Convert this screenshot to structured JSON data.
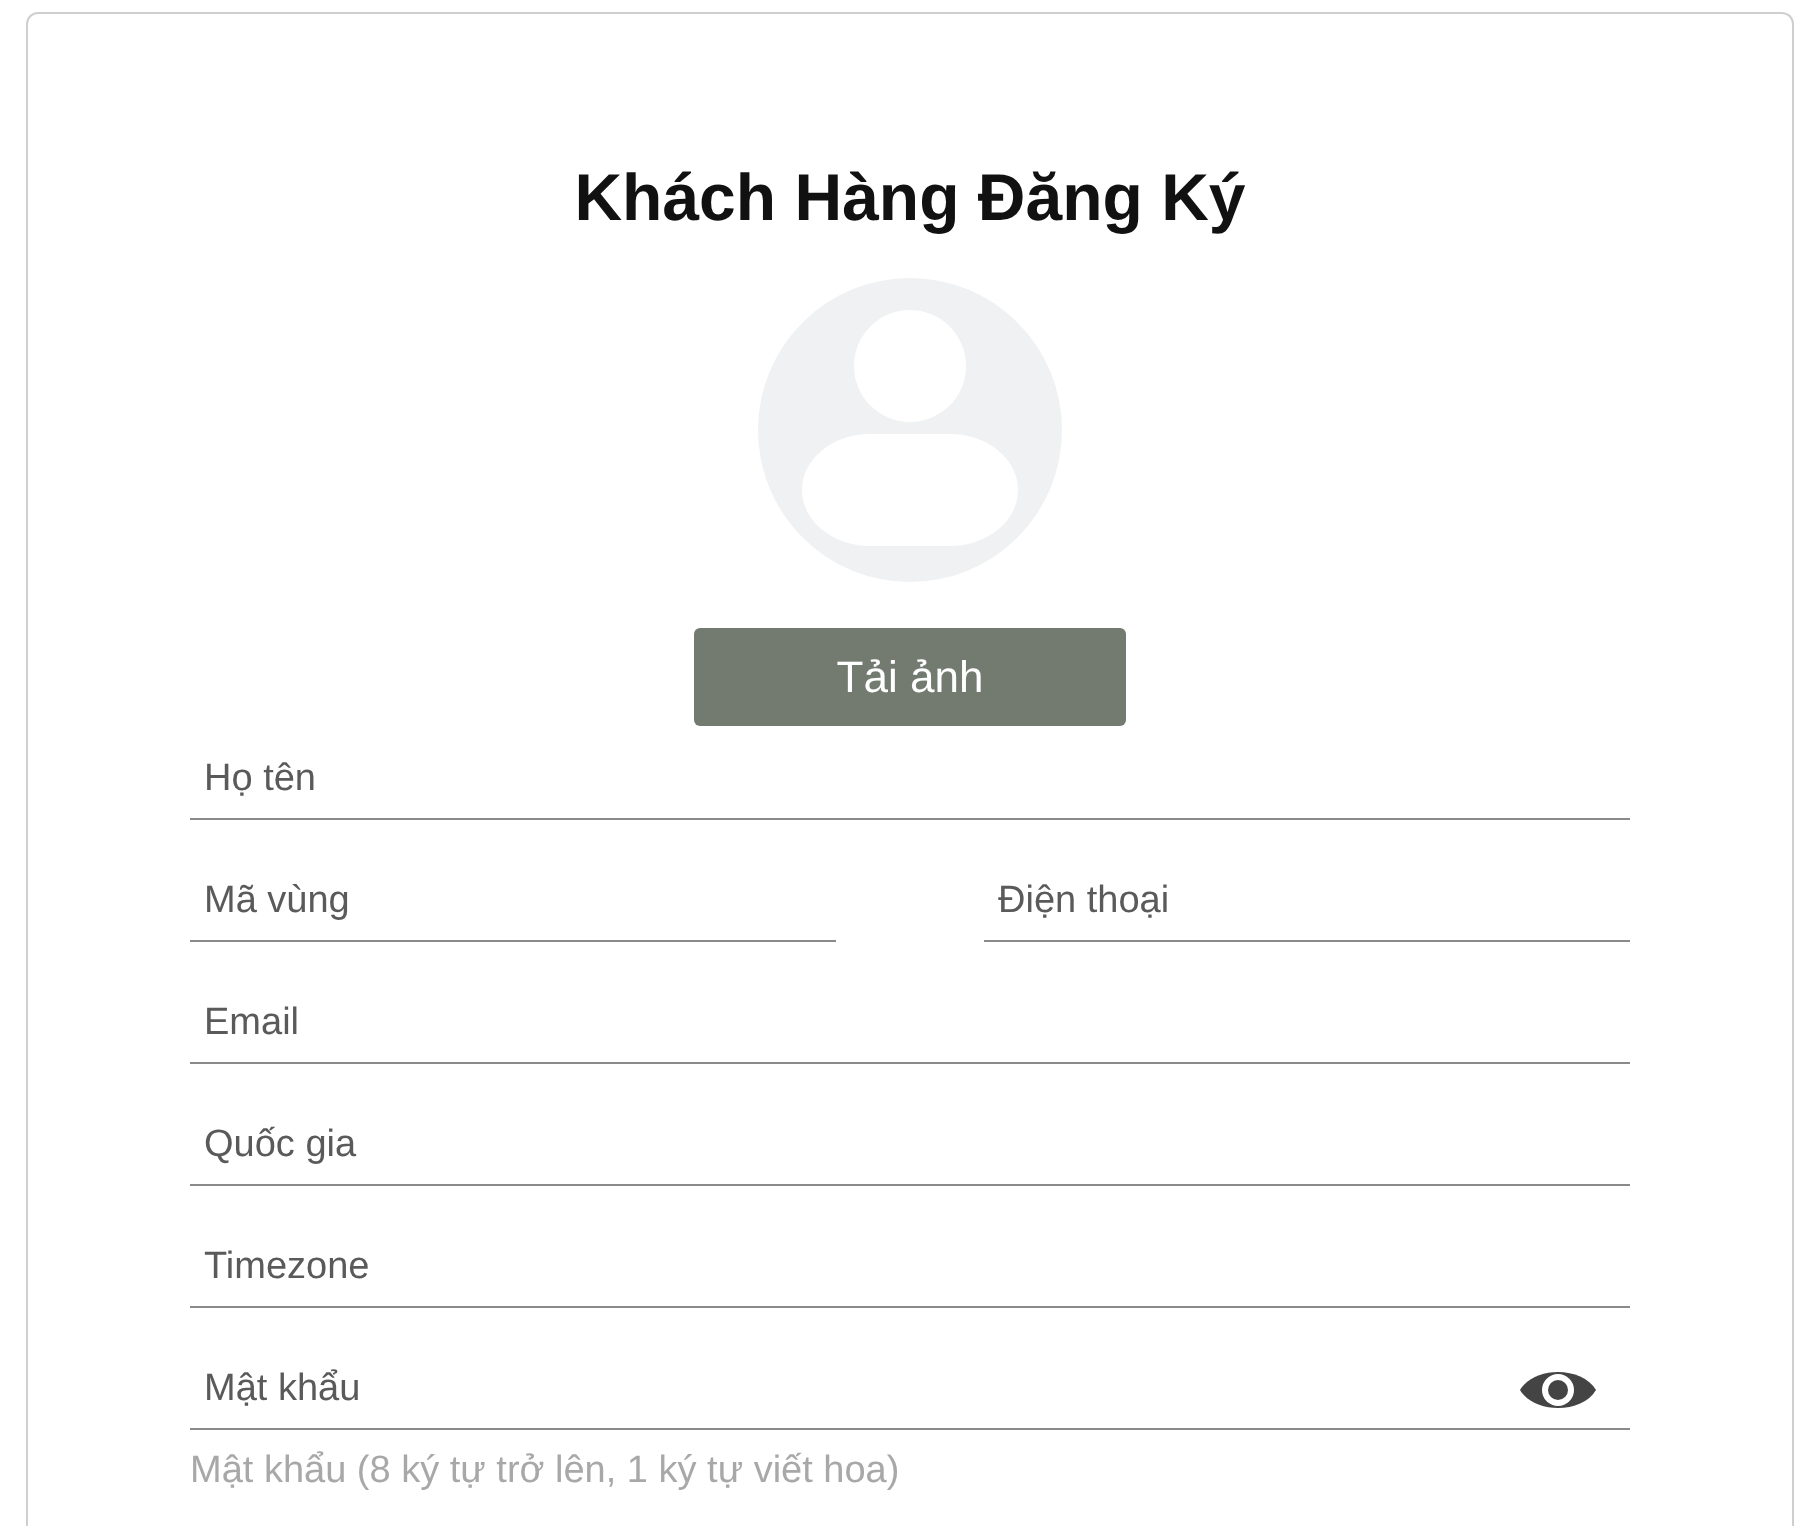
{
  "title": "Khách Hàng Đăng Ký",
  "upload_button": "Tải ảnh",
  "field_rows": [
    [
      {
        "placeholder": "Họ tên",
        "reveal_toggle": false
      }
    ],
    [
      {
        "placeholder": "Mã vùng",
        "reveal_toggle": false
      },
      {
        "placeholder": "Điện thoại",
        "reveal_toggle": false
      }
    ],
    [
      {
        "placeholder": "Email",
        "reveal_toggle": false
      }
    ],
    [
      {
        "placeholder": "Quốc gia",
        "reveal_toggle": false
      }
    ],
    [
      {
        "placeholder": "Timezone",
        "reveal_toggle": false
      }
    ],
    [
      {
        "placeholder": "Mật khẩu",
        "reveal_toggle": true
      }
    ]
  ],
  "password_hint": "Mật khẩu (8 ký tự trở lên, 1 ký tự viết hoa)"
}
